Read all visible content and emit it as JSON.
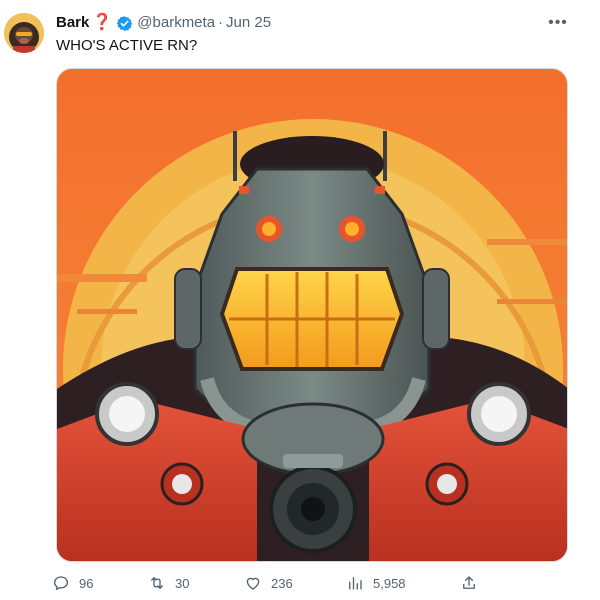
{
  "tweet": {
    "author": {
      "name": "Bark",
      "name_suffix": "❓",
      "handle": "@barkmeta",
      "separator": "·",
      "date": "Jun 25",
      "verified": true
    },
    "text": "WHO'S ACTIVE RN?",
    "more_label": "•••",
    "media_description_icon": "robot-gorilla-image",
    "actions": {
      "replies": "96",
      "retweets": "30",
      "likes": "236",
      "views": "5,958"
    }
  },
  "colors": {
    "verified_blue": "#1d9bf0",
    "muted_text": "#536471",
    "primary_text": "#0f1419",
    "sky_orange": "#f47a34",
    "sun_yellow": "#f3c25d",
    "armor_red": "#d8402c"
  }
}
